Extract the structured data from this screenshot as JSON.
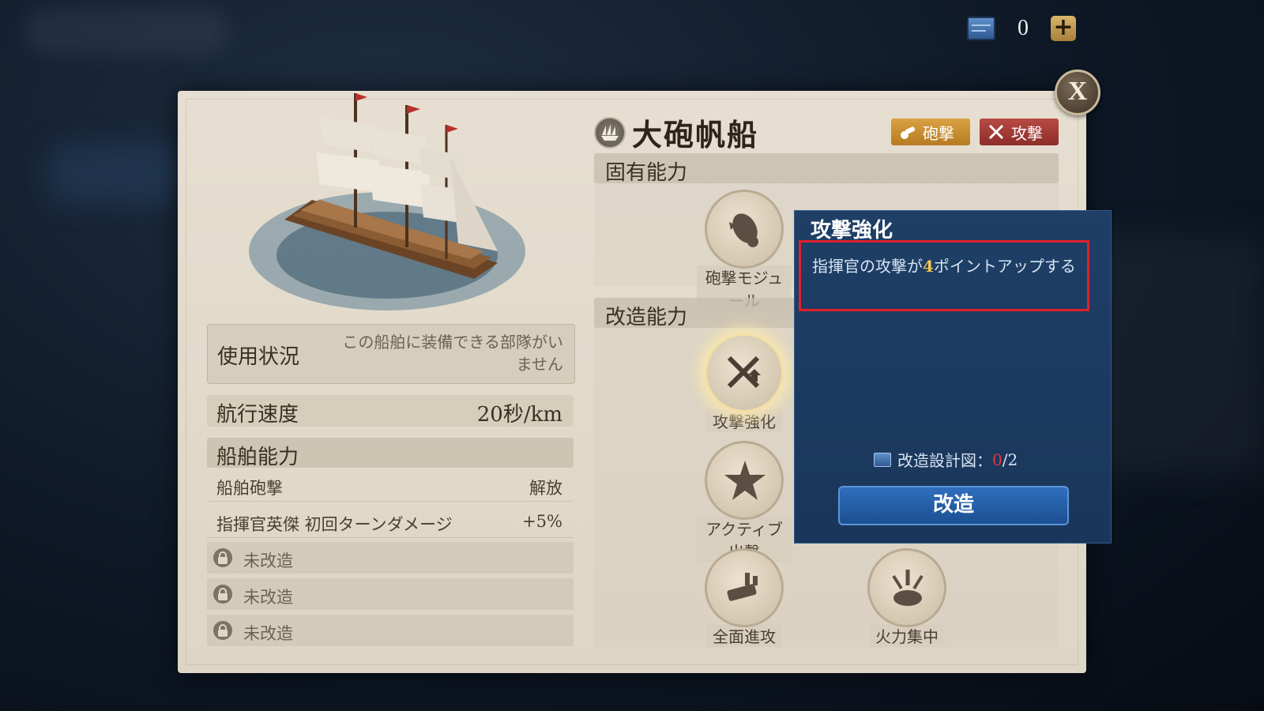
{
  "currency": {
    "value": "0",
    "add_label": "+"
  },
  "close_label": "X",
  "ship": {
    "name": "大砲帆船",
    "tags": [
      {
        "label": "砲撃",
        "color": "#c98f33"
      },
      {
        "label": "攻撃",
        "color": "#a13a35"
      }
    ]
  },
  "usage": {
    "label": "使用状況",
    "value": "この船舶に装備できる部隊がいません"
  },
  "speed": {
    "label": "航行速度",
    "value": "20秒/km"
  },
  "abilities": {
    "header": "船舶能力",
    "rows": [
      {
        "name": "船舶砲撃",
        "value": "解放"
      },
      {
        "name": "指揮官英傑 初回ターンダメージ",
        "value": "+5%"
      }
    ],
    "locked": [
      "未改造",
      "未改造",
      "未改造"
    ]
  },
  "sections": {
    "innate": "固有能力",
    "mod": "改造能力"
  },
  "skills": {
    "innate": [
      "砲撃モジュール"
    ],
    "mod": [
      "攻撃強化",
      "アクティブ出撃",
      "全面進攻",
      "火力集中"
    ]
  },
  "tooltip": {
    "title": "攻撃強化",
    "desc_before": "指揮官の攻撃が",
    "desc_num": "4",
    "desc_after": "ポイントアップする",
    "blueprint_label": "改造設計図：",
    "blueprint_have": "0",
    "blueprint_need": "/2",
    "button": "改造"
  },
  "colors": {
    "highlight_border": "#e0202a",
    "tooltip_bg": "#1f3f67",
    "accent_number": "#f1c453"
  }
}
